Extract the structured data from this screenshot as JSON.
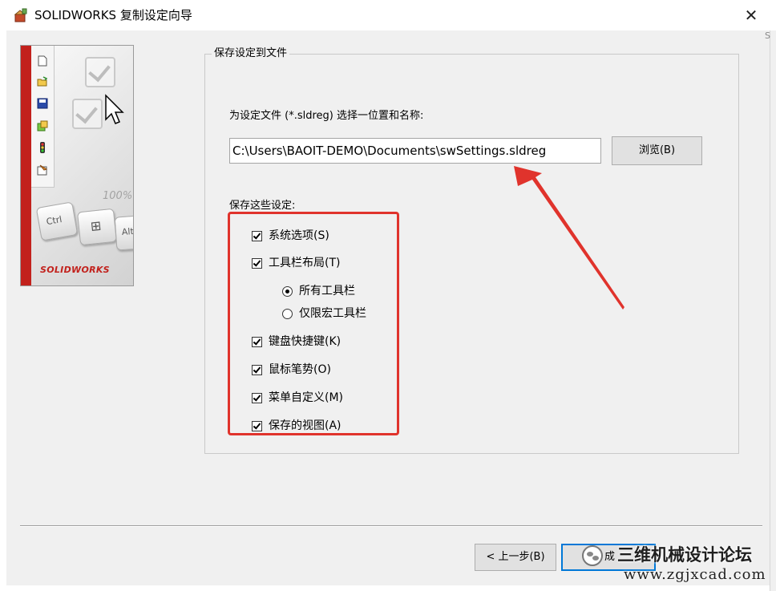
{
  "window": {
    "title": "SOLIDWORKS 复制设定向导",
    "close_glyph": "✕",
    "app_icon": "solidworks-app-icon"
  },
  "scrollbar_glimpse": "S",
  "side_image": {
    "brand_logo": "SOLIDWORKS",
    "keys": [
      "Ctrl",
      "⊞",
      "Alt"
    ],
    "percent": "100%",
    "toolbar_icons": [
      "new-document-icon",
      "open-folder-icon",
      "save-icon",
      "options-icon",
      "traffic-light-icon",
      "properties-icon"
    ]
  },
  "group": {
    "legend": "保存设定到文件",
    "prompt": "为设定文件 (*.sldreg) 选择一位置和名称:",
    "path_value": "C:\\Users\\BAOIT-DEMO\\Documents\\swSettings.sldreg",
    "browse_label": "浏览(B)",
    "save_settings_label": "保存这些设定:",
    "options": {
      "system_options": {
        "label": "系统选项(S)",
        "checked": true
      },
      "toolbar_layout": {
        "label": "工具栏布局(T)",
        "checked": true
      },
      "all_toolbars": {
        "label": "所有工具栏",
        "selected": true
      },
      "macro_toolbar_only": {
        "label": "仅限宏工具栏",
        "selected": false
      },
      "keyboard_shortcuts": {
        "label": "键盘快捷键(K)",
        "checked": true
      },
      "mouse_gestures": {
        "label": "鼠标笔势(O)",
        "checked": true
      },
      "menu_customization": {
        "label": "菜单自定义(M)",
        "checked": true
      },
      "saved_views": {
        "label": "保存的视图(A)",
        "checked": true
      }
    }
  },
  "annotation": {
    "color": "#e0332c"
  },
  "buttons": {
    "back_label": "< 上一步(B)",
    "finish_label": "成"
  },
  "watermark": {
    "name": "三维机械设计论坛",
    "url": "www.zgjxcad.com"
  },
  "colors": {
    "dialog_bg": "#f0f0f0",
    "focus_border": "#0078d7",
    "brand_red": "#c2211c"
  }
}
